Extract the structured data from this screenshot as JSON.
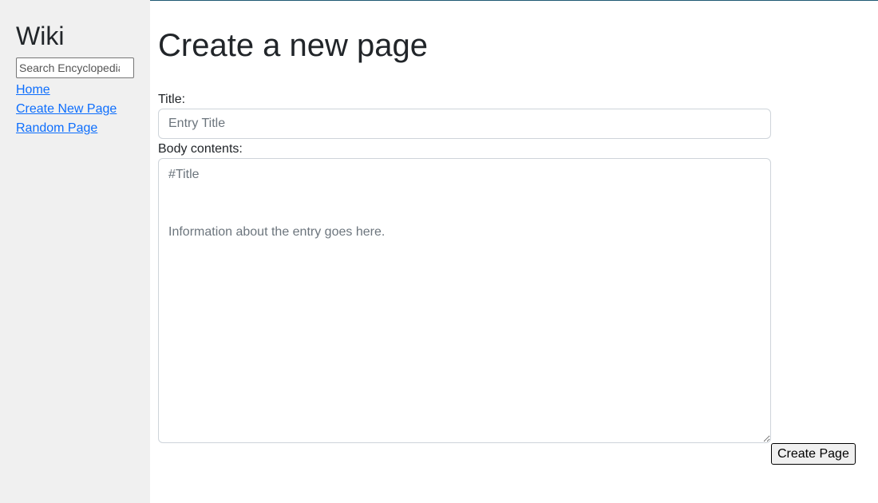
{
  "sidebar": {
    "title": "Wiki",
    "search": {
      "placeholder": "Search Encyclopedia",
      "value": ""
    },
    "links": [
      {
        "label": "Home"
      },
      {
        "label": "Create New Page"
      },
      {
        "label": "Random Page"
      }
    ]
  },
  "main": {
    "heading": "Create a new page",
    "title_field": {
      "label": "Title:",
      "placeholder": "Entry Title",
      "value": ""
    },
    "body_field": {
      "label": "Body contents:",
      "placeholder": "#Title\n\n\nInformation about the entry goes here.",
      "value": ""
    },
    "submit_label": "Create Page"
  },
  "colors": {
    "sidebar_bg": "#f0f0f0",
    "link": "#0d6efd",
    "text": "#212529",
    "input_border": "#ced4da",
    "placeholder": "#6c757d"
  }
}
